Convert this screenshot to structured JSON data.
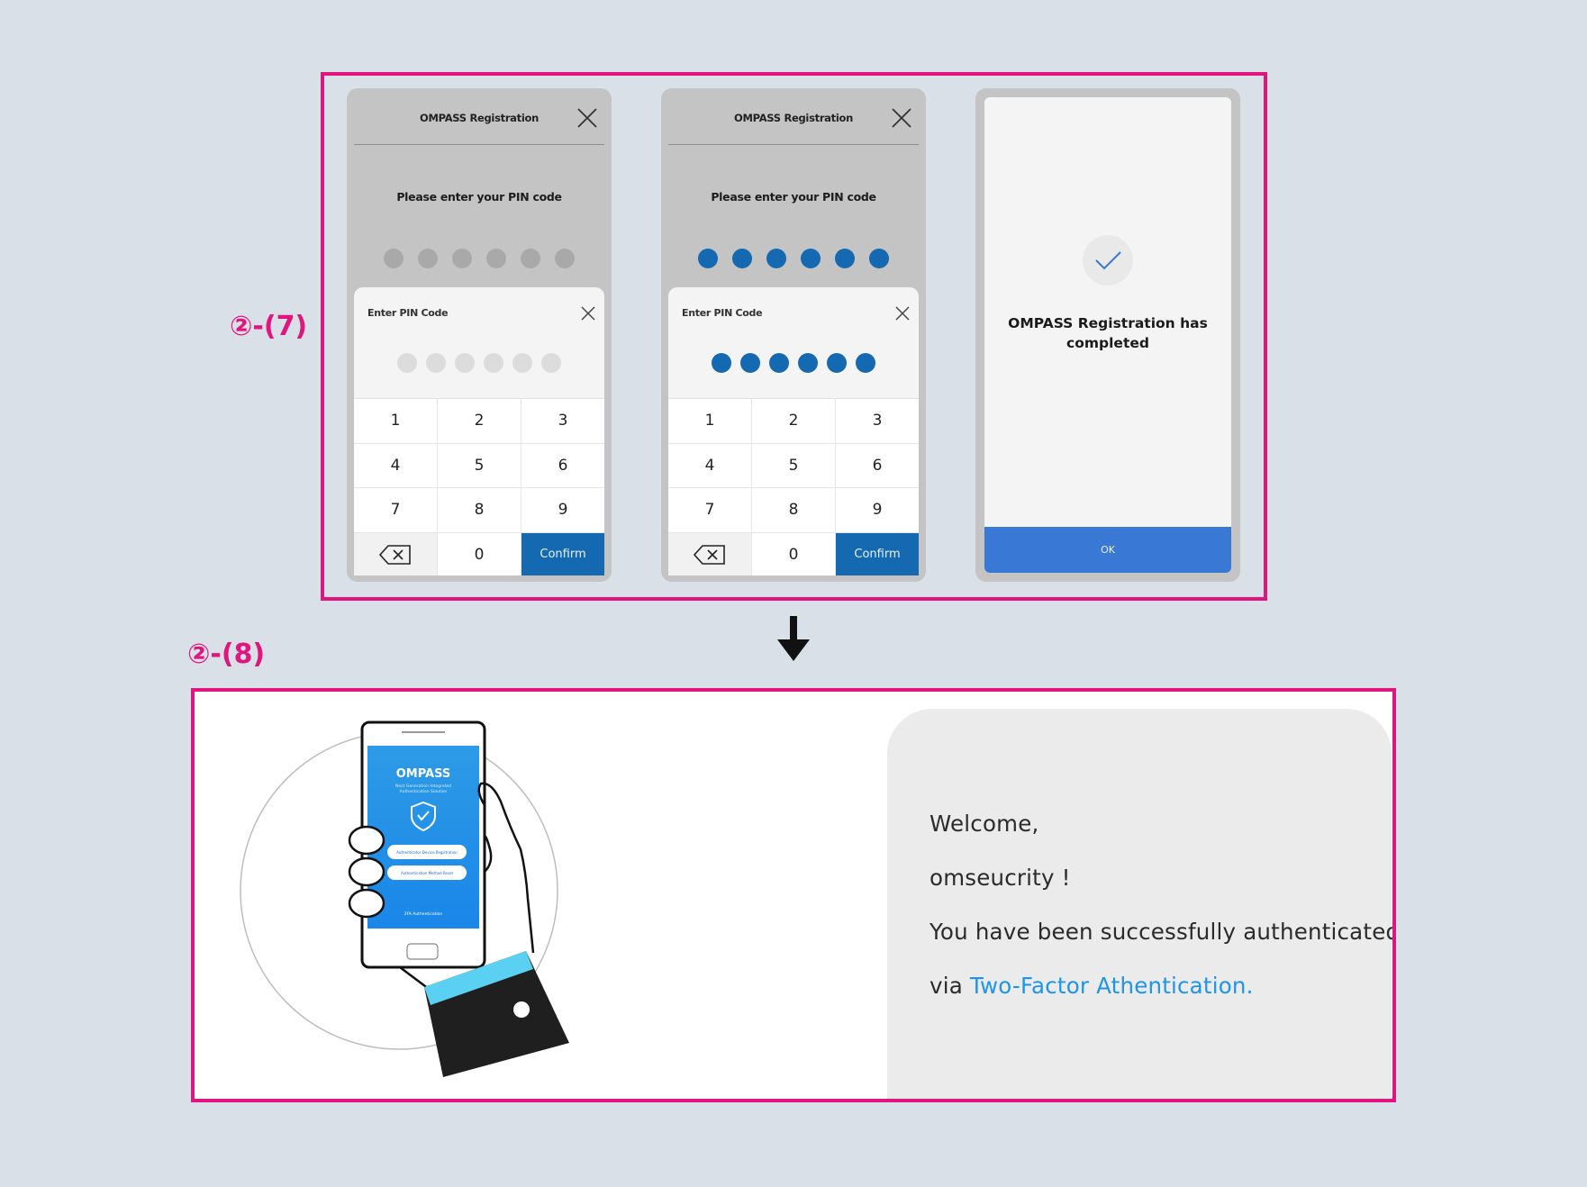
{
  "labels": {
    "step7": "②-(7)",
    "step8": "②-(8)"
  },
  "phone1": {
    "title": "OMPASS Registration",
    "prompt": "Please enter your PIN code",
    "pin_filled": 0,
    "sheet_title": "Enter PIN Code",
    "keys": [
      "1",
      "2",
      "3",
      "4",
      "5",
      "6",
      "7",
      "8",
      "9",
      "",
      "0",
      "Confirm"
    ]
  },
  "phone2": {
    "title": "OMPASS Registration",
    "prompt": "Please enter your PIN code",
    "pin_filled": 6,
    "sheet_title": "Enter PIN Code",
    "keys": [
      "1",
      "2",
      "3",
      "4",
      "5",
      "6",
      "7",
      "8",
      "9",
      "",
      "0",
      "Confirm"
    ]
  },
  "phone3": {
    "message_line1": "OMPASS Registration has",
    "message_line2": "completed",
    "ok_label": "OK"
  },
  "illustration": {
    "app_name": "OMPASS",
    "app_subtitle_1": "Next Generation Integrated",
    "app_subtitle_2": "Authentication Solution",
    "btn1": "Authenticator Device Registration",
    "btn2": "Authentication Method Reset",
    "footer": "2FA Authentication"
  },
  "welcome": {
    "line1": "Welcome,",
    "line2": "omseucrity !",
    "line3": "You have been successfully authenticated",
    "line4_prefix": "via ",
    "line4_link": "Two-Factor Athentication."
  },
  "colors": {
    "accent_magenta": "#e0157d",
    "pin_filled": "#1469b0",
    "pin_empty": "#a9a9a9",
    "ok_blue": "#3a78d6",
    "link_blue": "#1d95ea"
  }
}
